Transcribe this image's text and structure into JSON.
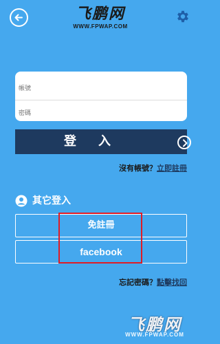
{
  "header": {
    "logo_text": "飞鹏网",
    "logo_url": "WWW.FPWAP.COM",
    "back_icon": "back-arrow-icon",
    "settings_icon": "gear-icon"
  },
  "form": {
    "account_placeholder": "帳號",
    "password_placeholder": "密碼"
  },
  "login_button": {
    "label": "登入",
    "icon": "chevron-right-circle-icon"
  },
  "register": {
    "prompt": "沒有帳號？",
    "link": "立即註冊"
  },
  "other_login": {
    "title": "其它登入",
    "icon": "user-icon",
    "guest_label": "免註冊",
    "facebook_label": "facebook"
  },
  "forgot": {
    "prompt": "忘記密碼？",
    "link": "點擊找回"
  },
  "watermark": {
    "text": "飞鹏网",
    "url": "WWW.FPWAP.COM"
  },
  "colors": {
    "background": "#45a8ee",
    "button_dark": "#1e3a5f",
    "highlight": "#e01b24"
  }
}
